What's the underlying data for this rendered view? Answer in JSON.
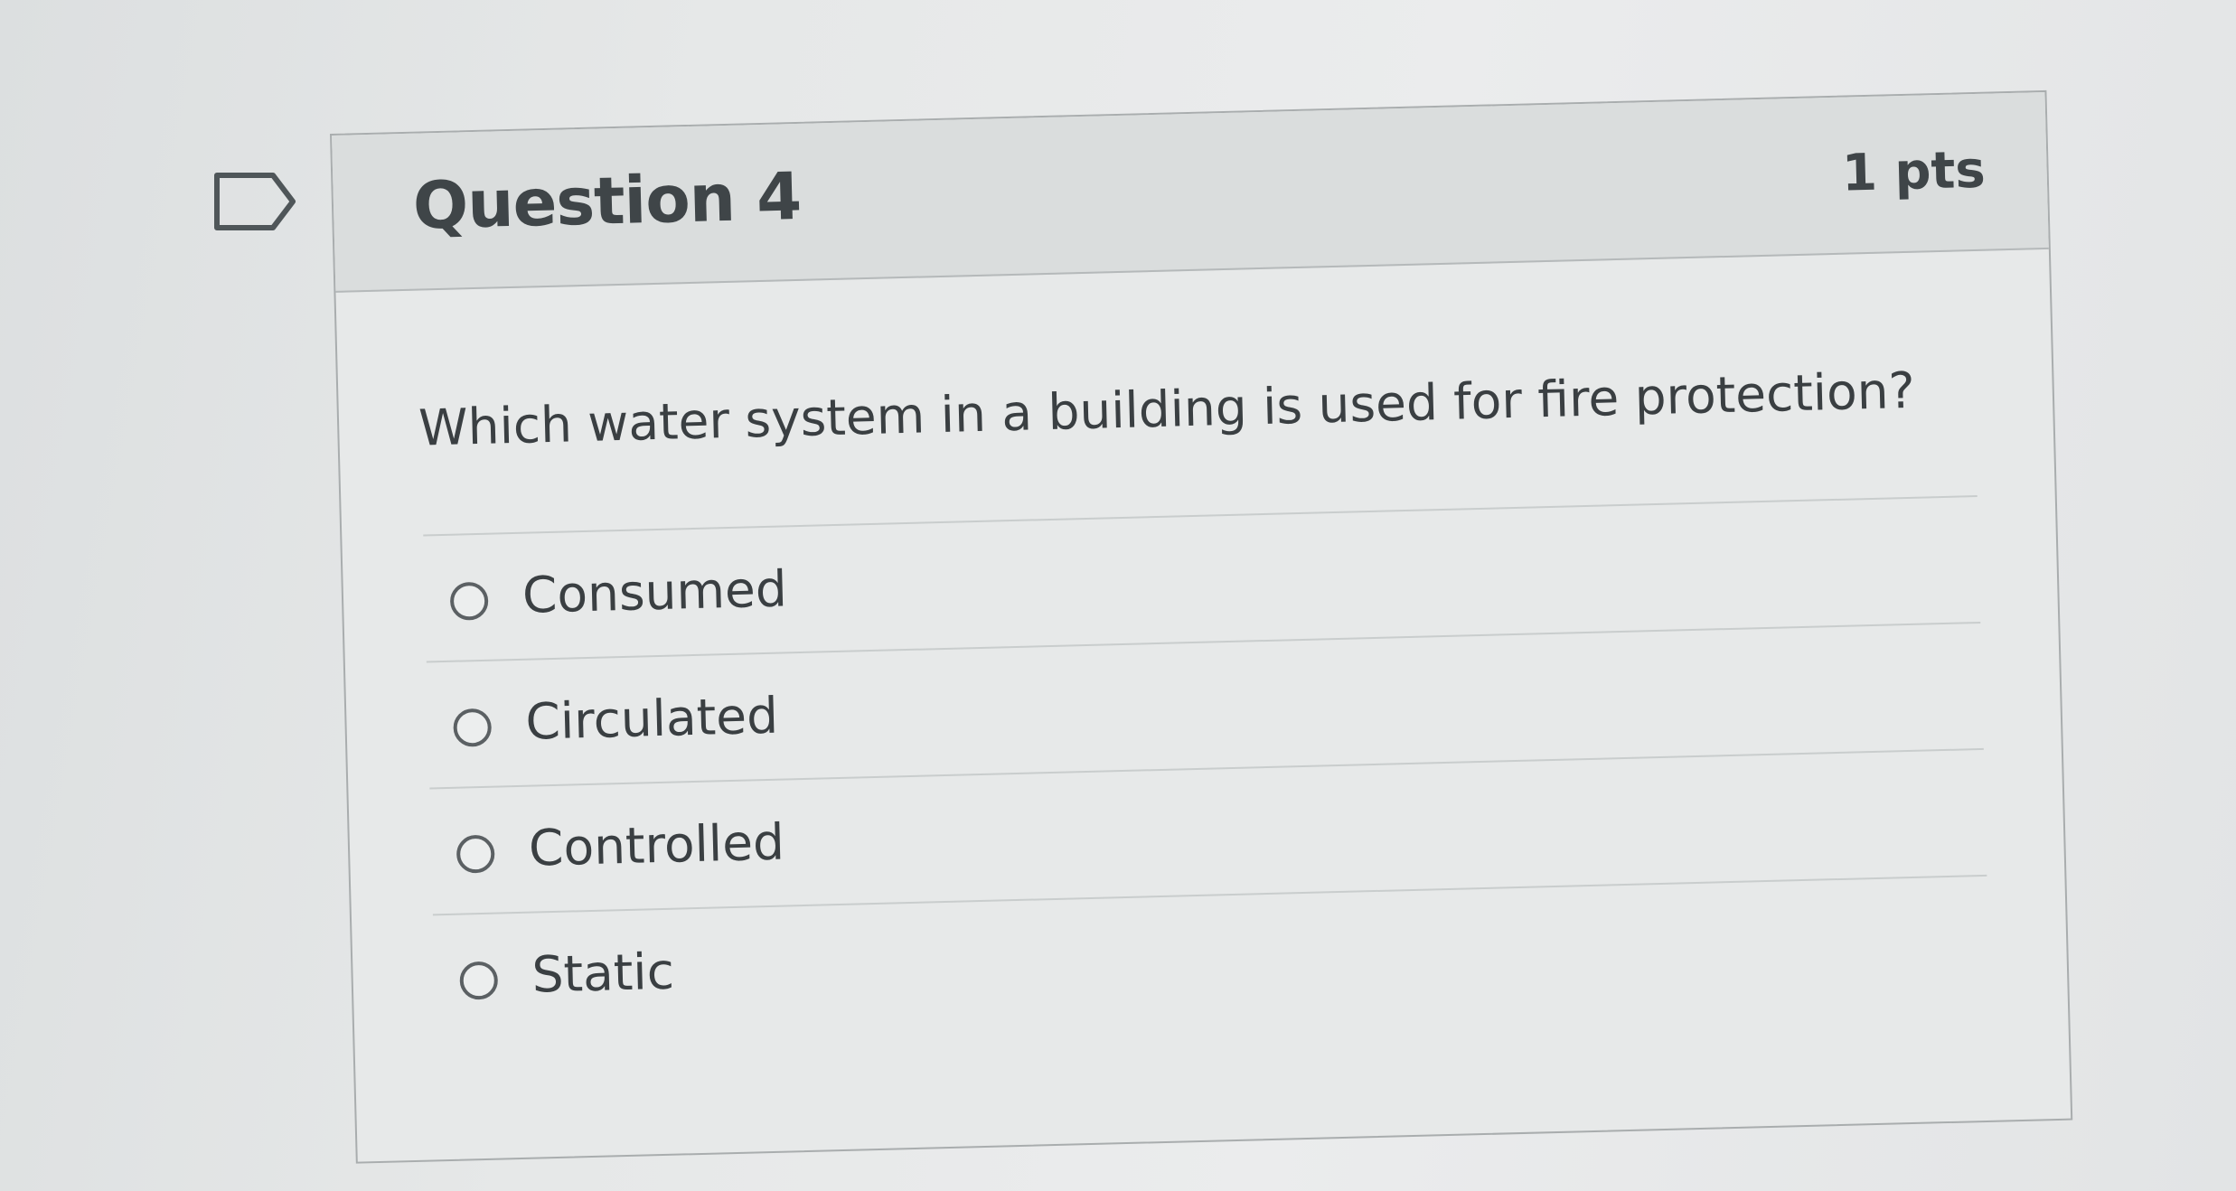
{
  "question": {
    "title": "Question 4",
    "points": "1 pts",
    "text": "Which water system in a building is used for fire protection?",
    "flag_icon": "flag-outline-icon"
  },
  "answers": [
    {
      "label": "Consumed",
      "selected": false
    },
    {
      "label": "Circulated",
      "selected": false
    },
    {
      "label": "Controlled",
      "selected": false
    },
    {
      "label": "Static",
      "selected": false
    }
  ]
}
